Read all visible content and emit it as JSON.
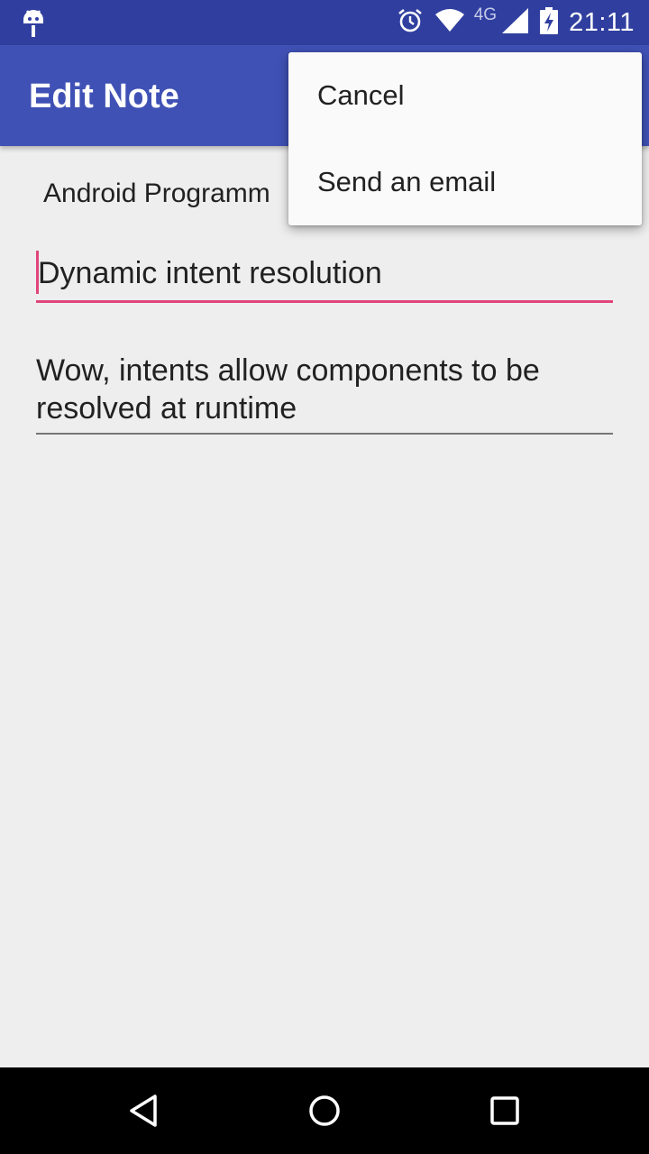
{
  "status_bar": {
    "network_type": "4G",
    "time": "21:11",
    "icons": [
      "android-debug-icon",
      "alarm-icon",
      "wifi-icon",
      "cell-signal-icon",
      "battery-charging-icon"
    ]
  },
  "app_bar": {
    "title": "Edit Note"
  },
  "note": {
    "course": "Android Programm",
    "title": "Dynamic intent resolution",
    "text": "Wow, intents allow components to be resolved at runtime"
  },
  "overflow_menu": {
    "items": [
      {
        "label": "Cancel"
      },
      {
        "label": "Send an email"
      }
    ]
  },
  "nav_bar": {
    "icons": [
      "back-icon",
      "home-icon",
      "recents-icon"
    ]
  },
  "colors": {
    "status_bar": "#303f9f",
    "primary": "#3f51b5",
    "accent": "#e0457b",
    "background": "#eeeeee"
  }
}
